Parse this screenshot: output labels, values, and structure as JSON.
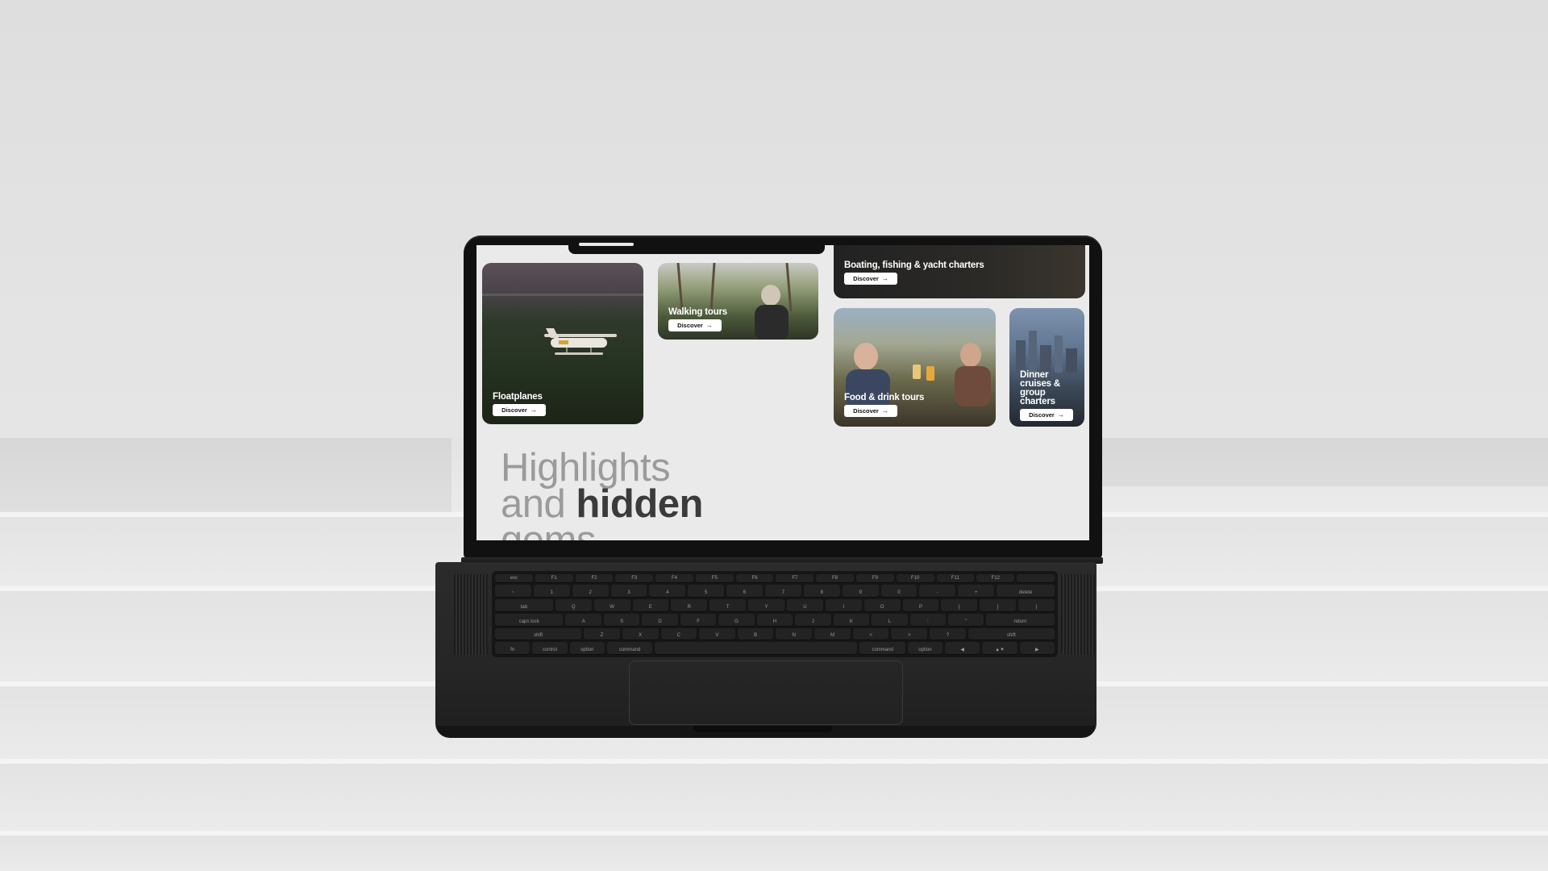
{
  "cards": [
    {
      "label": "Floatplanes",
      "button": "Discover"
    },
    {
      "label": "Walking tours",
      "button": "Discover"
    },
    {
      "label": "Boating, fishing & yacht charters",
      "button": "Discover"
    },
    {
      "label": "Food & drink tours",
      "button": "Discover"
    },
    {
      "label_lines": [
        "Dinner",
        "cruises &",
        "group",
        "charters"
      ],
      "button": "Discover"
    }
  ],
  "headline": {
    "line1": "Highlights",
    "line2_light": "and ",
    "line2_bold": "hidden",
    "line3": "gems"
  },
  "keyboard": {
    "row1": [
      "esc",
      "F1",
      "F2",
      "F3",
      "F4",
      "F5",
      "F6",
      "F7",
      "F8",
      "F9",
      "F10",
      "F11",
      "F12",
      ""
    ],
    "row2": [
      "~",
      "1",
      "2",
      "3",
      "4",
      "5",
      "6",
      "7",
      "8",
      "9",
      "0",
      "-",
      "+",
      "delete"
    ],
    "row3": [
      "tab",
      "Q",
      "W",
      "E",
      "R",
      "T",
      "Y",
      "U",
      "I",
      "O",
      "P",
      "{",
      "}",
      "|"
    ],
    "row4": [
      "caps lock",
      "A",
      "S",
      "D",
      "F",
      "G",
      "H",
      "J",
      "K",
      "L",
      ":",
      "\"",
      "return"
    ],
    "row5": [
      "shift",
      "Z",
      "X",
      "C",
      "V",
      "B",
      "N",
      "M",
      "<",
      ">",
      "?",
      "shift"
    ],
    "row6": [
      "fn",
      "control",
      "option",
      "command",
      "",
      "command",
      "option",
      "◀",
      "▲▼",
      "▶"
    ]
  }
}
